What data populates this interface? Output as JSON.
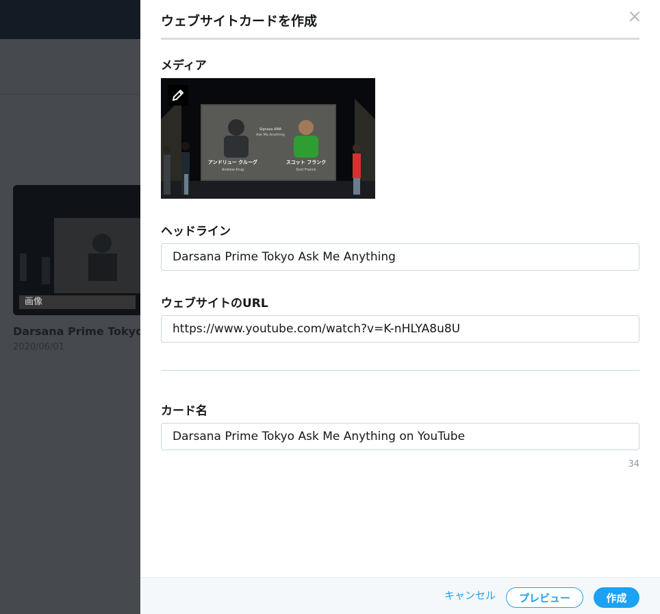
{
  "background": {
    "card": {
      "badge": "画像",
      "title": "Darsana Prime Tokyo A",
      "date": "2020/06/01"
    }
  },
  "modal": {
    "title": "ウェブサイトカードを作成",
    "media": {
      "label": "メディア",
      "slide_left_name_jp": "アンドリュー クルーグ",
      "slide_left_name_en": "Andrew Krug",
      "slide_center_title": "Signasa AMA",
      "slide_center_subtitle": "Ask Me Anything",
      "slide_right_name_jp": "スコット フランク",
      "slide_right_name_en": "Scot Franck"
    },
    "headline": {
      "label": "ヘッドライン",
      "value": "Darsana Prime Tokyo Ask Me Anything"
    },
    "url": {
      "label": "ウェブサイトのURL",
      "value": "https://www.youtube.com/watch?v=K-nHLYA8u8U"
    },
    "card_name": {
      "label": "カード名",
      "value": "Darsana Prime Tokyo Ask Me Anything on YouTube",
      "counter": "34"
    },
    "footer": {
      "cancel": "キャンセル",
      "preview": "プレビュー",
      "create": "作成"
    }
  },
  "colors": {
    "accent": "#1da1f2",
    "overlay": "#46494e",
    "topbar": "#141b24"
  }
}
